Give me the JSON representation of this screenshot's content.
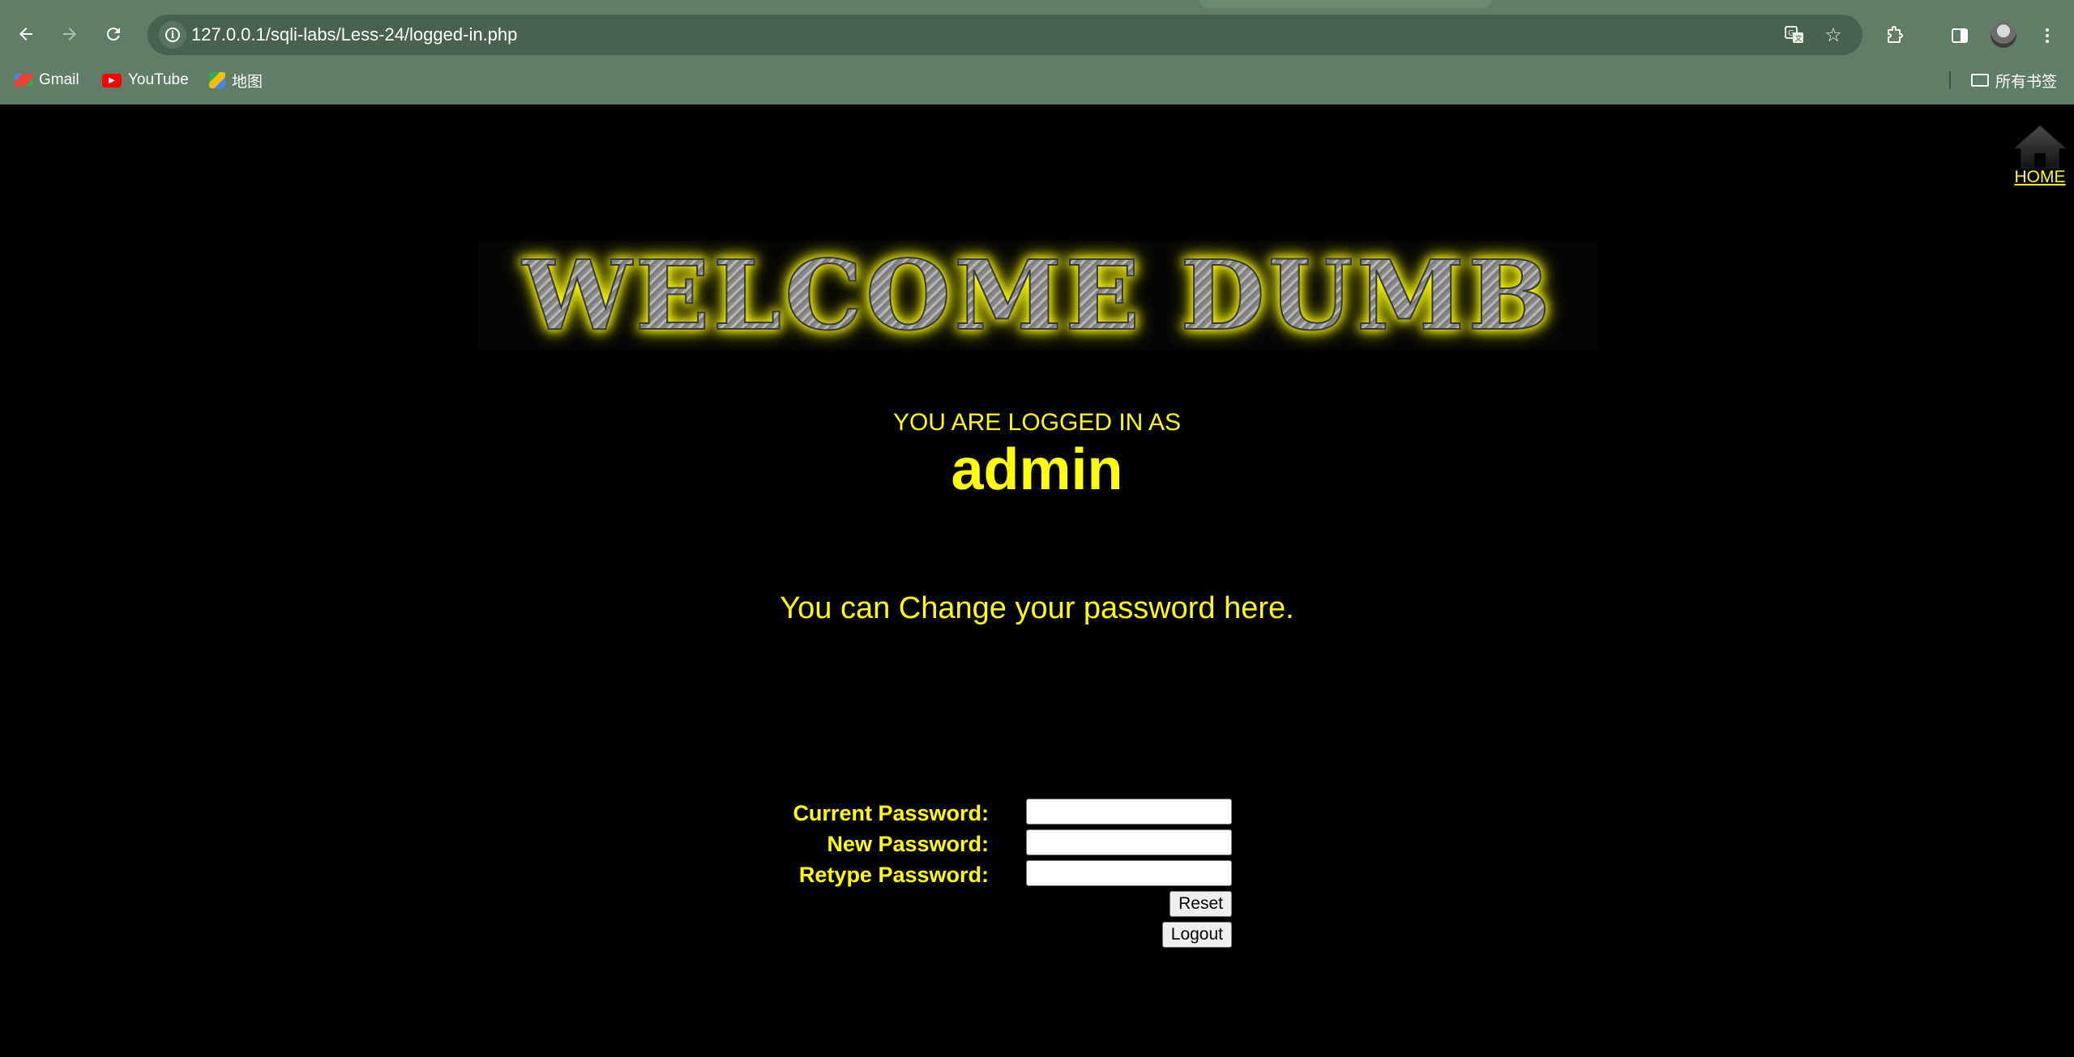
{
  "browser": {
    "url": "127.0.0.1/sqli-labs/Less-24/logged-in.php",
    "bookmarks": [
      {
        "label": "Gmail",
        "icon": "gmail-icon"
      },
      {
        "label": "YouTube",
        "icon": "youtube-icon"
      },
      {
        "label": "地图",
        "icon": "maps-icon"
      }
    ],
    "all_bookmarks_label": "所有书签"
  },
  "page": {
    "home_label": "HOME",
    "banner_text": "WELCOME DUMB",
    "logged_in_label": "YOU ARE LOGGED IN AS",
    "username": "admin",
    "change_message": "You can Change your password here.",
    "form": {
      "current_password_label": "Current Password:",
      "new_password_label": "New Password:",
      "retype_password_label": "Retype Password:",
      "reset_label": "Reset",
      "logout_label": "Logout"
    },
    "colors": {
      "background": "#000000",
      "text_accent": "#ffff00",
      "chrome_bg": "#5f7d67"
    }
  }
}
